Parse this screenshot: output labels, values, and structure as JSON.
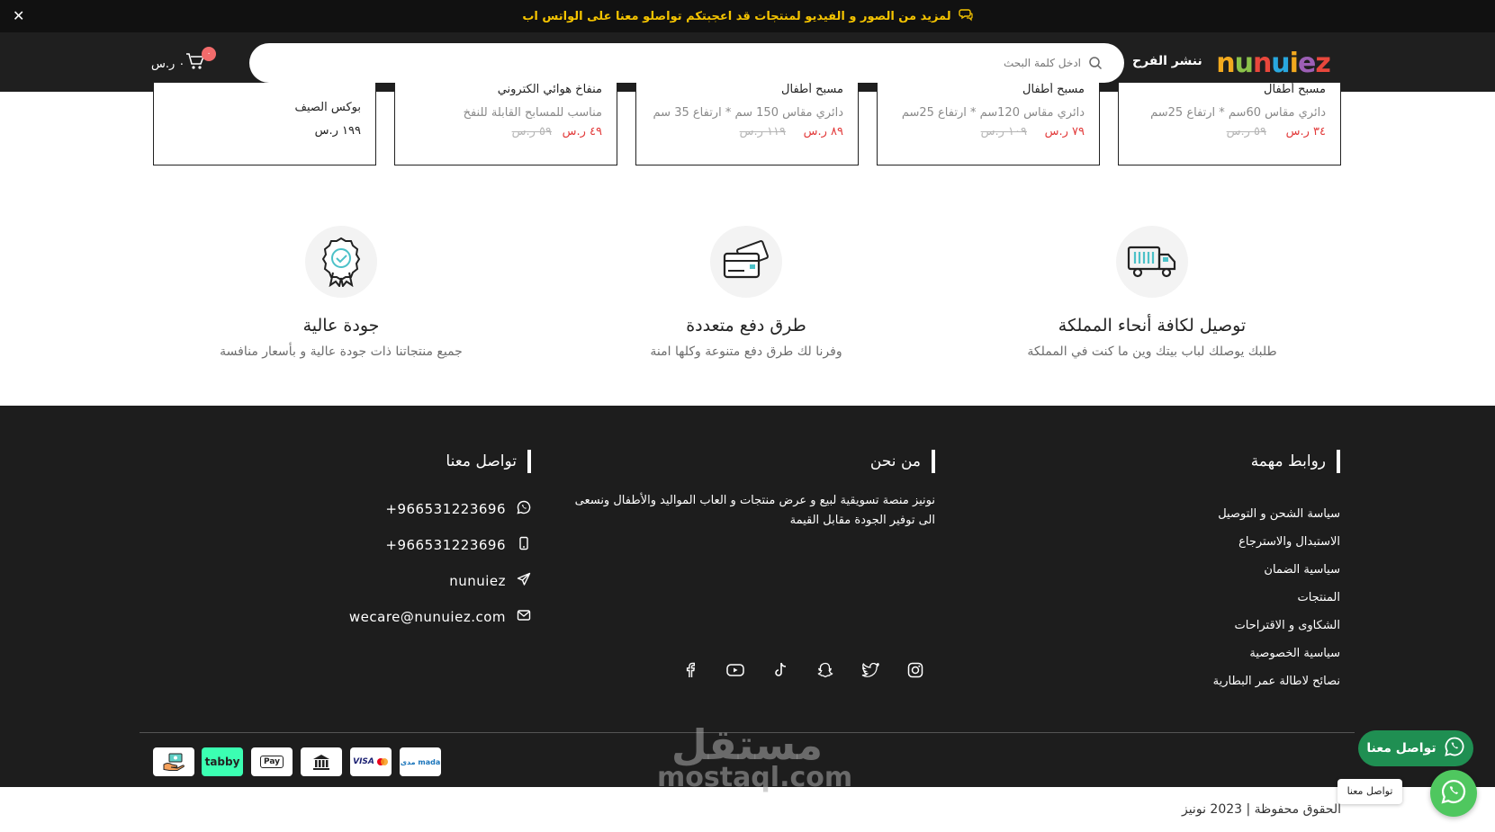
{
  "announcement": {
    "text": "لمزيد من الصور و الفيديو لمنتجات قد اعجبتكم تواصلو معنا على الواتس اب",
    "close": "✕"
  },
  "header": {
    "logo": "nunuiez",
    "link": "ننشر الفرح",
    "search_placeholder": "ادخل كلمة البحث",
    "cart_badge": "٠",
    "cart_total": "٠ ر.س"
  },
  "products": [
    {
      "name": "مسبح أطفال",
      "desc": "دائري مقاس 60سم * ارتفاع 25سم",
      "price": "٣٤ ر.س",
      "old": "٥٩ ر.س"
    },
    {
      "name": "مسبح أطفال",
      "desc": "دائري مقاس 120سم * ارتفاع 25سم",
      "price": "٧٩ ر.س",
      "old": "١٠٩ ر.س"
    },
    {
      "name": "مسبح أطفال",
      "desc": "دائري مقاس 150 سم * ارتفاع 35 سم",
      "price": "٨٩ ر.س",
      "old": "١١٩ ر.س"
    },
    {
      "name": "منفاخ هوائي الكتروني",
      "desc": "مناسب للمسابح القابلة للنفخ",
      "price": "٤٩ ر.س",
      "old": "٥٩ ر.س"
    },
    {
      "name": "بوكس الصيف",
      "regular": "١٩٩ ر.س"
    }
  ],
  "features": [
    {
      "title": "توصيل لكافة أنحاء المملكة",
      "text": "طلبك يوصلك لباب بيتك وين ما كنت في المملكة",
      "icon": "truck-icon"
    },
    {
      "title": "طرق دفع متعددة",
      "text": "وفرنا لك طرق دفع متنوعة وكلها امنة",
      "icon": "card-icon"
    },
    {
      "title": "جودة عالية",
      "text": "جميع منتجاتنا ذات جودة عالية و بأسعار منافسة",
      "icon": "badge-icon"
    }
  ],
  "footer": {
    "links_heading": "روابط مهمة",
    "links": [
      "سياسة الشحن و التوصيل",
      "الاستبدال والاسترجاع",
      "سياسية الضمان",
      "المنتجات",
      "الشكاوى و الاقتراحات",
      "سياسية الخصوصية",
      "نصائح لاطالة عمر البطارية"
    ],
    "about_heading": "من نحن",
    "about_text": "نونيز منصة تسويقية لبيع و عرض منتجات و العاب المواليد والأطفال ونسعى الى توفير الجودة مقابل القيمة",
    "contact_heading": "تواصل معنا",
    "contact": {
      "whatsapp": "+966531223696",
      "phone": "+966531223696",
      "telegram": "nunuiez",
      "email": "wecare@nunuiez.com"
    },
    "payments": [
      "مدى mada",
      "VISA",
      "bank",
      "Pay",
      "tabby",
      "cod"
    ],
    "copyright": "الحقوق محفوظة | 2023 نونيز"
  },
  "watermark": {
    "ar": "مستقل",
    "en": "mostaql.com"
  },
  "whatsapp": {
    "pill": "تواصل معنا",
    "tooltip": "تواصل معنا"
  },
  "colors": {
    "accent": "#f5c400",
    "price": "#e23b3b",
    "dark": "#1d1d1d",
    "whatsapp": "#1f8f52"
  }
}
